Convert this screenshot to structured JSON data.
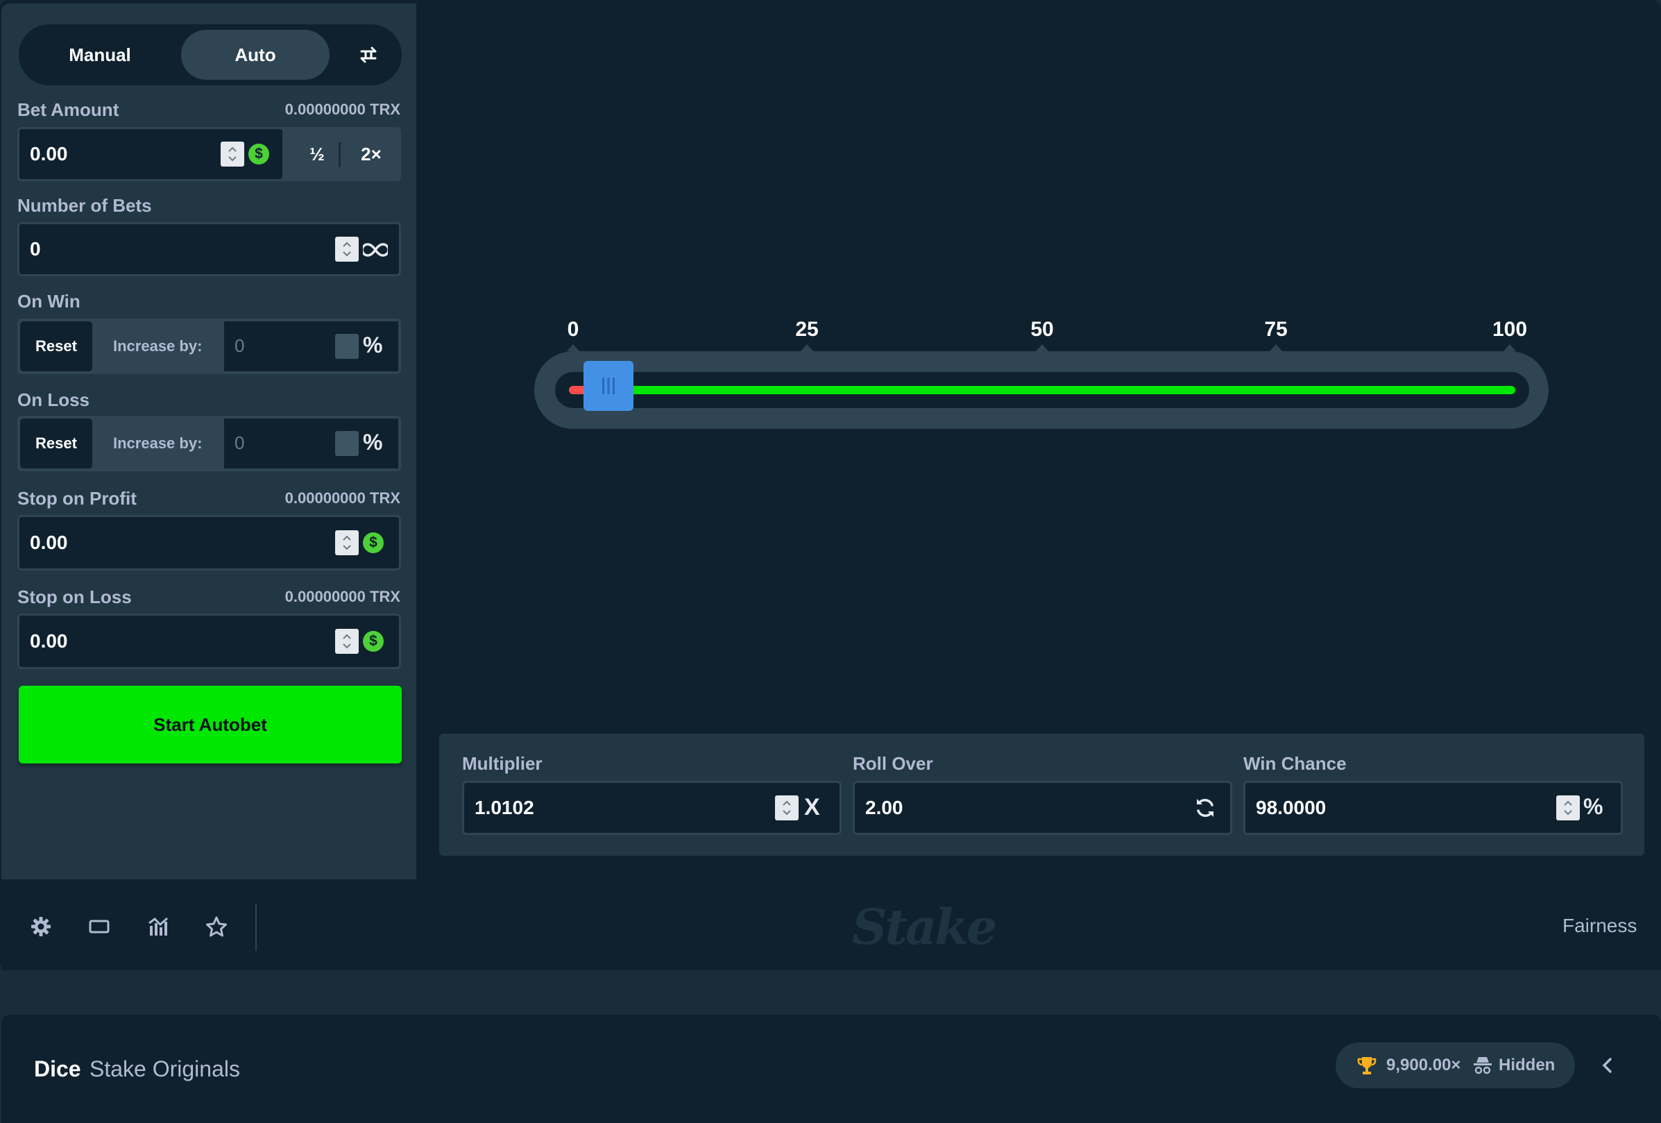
{
  "tabs": {
    "manual": "Manual",
    "auto": "Auto",
    "active": "Auto"
  },
  "bet_amount": {
    "label": "Bet Amount",
    "balance": "0.00000000 TRX",
    "value": "0.00",
    "half": "½",
    "double": "2×"
  },
  "number_of_bets": {
    "label": "Number of Bets",
    "value": "0"
  },
  "on_win": {
    "label": "On Win",
    "reset": "Reset",
    "increase_label": "Increase by:",
    "value": "0",
    "unit": "%"
  },
  "on_loss": {
    "label": "On Loss",
    "reset": "Reset",
    "increase_label": "Increase by:",
    "value": "0",
    "unit": "%"
  },
  "stop_on_profit": {
    "label": "Stop on Profit",
    "balance": "0.00000000 TRX",
    "value": "0.00"
  },
  "stop_on_loss": {
    "label": "Stop on Loss",
    "balance": "0.00000000 TRX",
    "value": "0.00"
  },
  "start_button": "Start Autobet",
  "slider": {
    "ticks": [
      "0",
      "25",
      "50",
      "75",
      "100"
    ],
    "value": 2
  },
  "multiplier": {
    "label": "Multiplier",
    "value": "1.0102",
    "unit": "X"
  },
  "roll_over": {
    "label": "Roll Over",
    "value": "2.00"
  },
  "win_chance": {
    "label": "Win Chance",
    "value": "98.0000",
    "unit": "%"
  },
  "toolbar": {
    "icons": [
      "gear-icon",
      "theatre-mode-icon",
      "stats-icon",
      "star-icon"
    ],
    "logo": "Stake",
    "fairness": "Fairness"
  },
  "footer": {
    "title": "Dice",
    "subtitle": "Stake Originals",
    "max_win": "9,900.00×",
    "privacy": "Hidden"
  },
  "colors": {
    "accent_green": "#00e701",
    "panel": "#213743",
    "background": "#0f212e",
    "slider_handle": "#4391e7",
    "red_zone": "#ff4d4d"
  }
}
